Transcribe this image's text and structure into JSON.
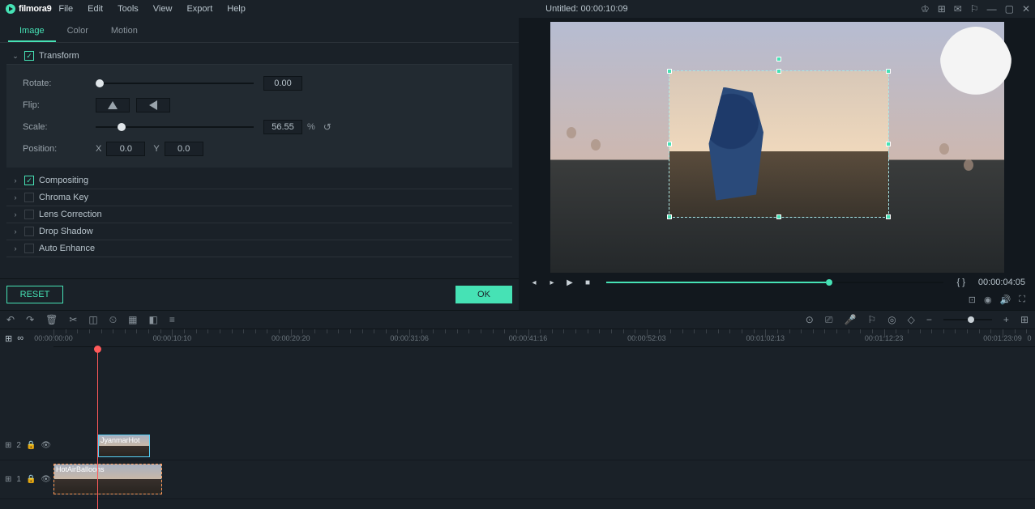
{
  "app": {
    "name": "filmora9",
    "title": "Untitled:",
    "timecode": "00:00:10:09"
  },
  "menu": {
    "file": "File",
    "edit": "Edit",
    "tools": "Tools",
    "view": "View",
    "export": "Export",
    "help": "Help"
  },
  "tabs": {
    "image": "Image",
    "color": "Color",
    "motion": "Motion"
  },
  "transform": {
    "title": "Transform",
    "rotate_label": "Rotate:",
    "rotate_value": "0.00",
    "flip_label": "Flip:",
    "scale_label": "Scale:",
    "scale_value": "56.55",
    "scale_unit": "%",
    "position_label": "Position:",
    "pos_x_label": "X",
    "pos_x": "0.0",
    "pos_y_label": "Y",
    "pos_y": "0.0"
  },
  "sections": {
    "compositing": "Compositing",
    "chroma": "Chroma Key",
    "lens": "Lens Correction",
    "shadow": "Drop Shadow",
    "enhance": "Auto Enhance"
  },
  "buttons": {
    "reset": "RESET",
    "ok": "OK"
  },
  "preview": {
    "duration": "00:00:04:05",
    "markers": "{  }"
  },
  "ruler": [
    "00:00:00:00",
    "00:00:10:10",
    "00:00:20:20",
    "00:00:31:06",
    "00:00:41:16",
    "00:00:52:03",
    "00:01:02:13",
    "00:01:12:23",
    "00:01:23:09"
  ],
  "ruler_end": "0",
  "tracks": {
    "t2": {
      "label": "2",
      "clip_name": "JyanmarHot"
    },
    "t1": {
      "label": "1",
      "clip_name": "HotAirBalloons"
    }
  },
  "icons": {
    "flip_h": "▲",
    "flip_v": "▶",
    "undo": "↶",
    "redo": "↷",
    "delete": "🗑",
    "split": "✂",
    "crop": "◫",
    "color": "◎",
    "speed": "⏱",
    "green": "◧",
    "rec": "●",
    "marker": "◇"
  }
}
